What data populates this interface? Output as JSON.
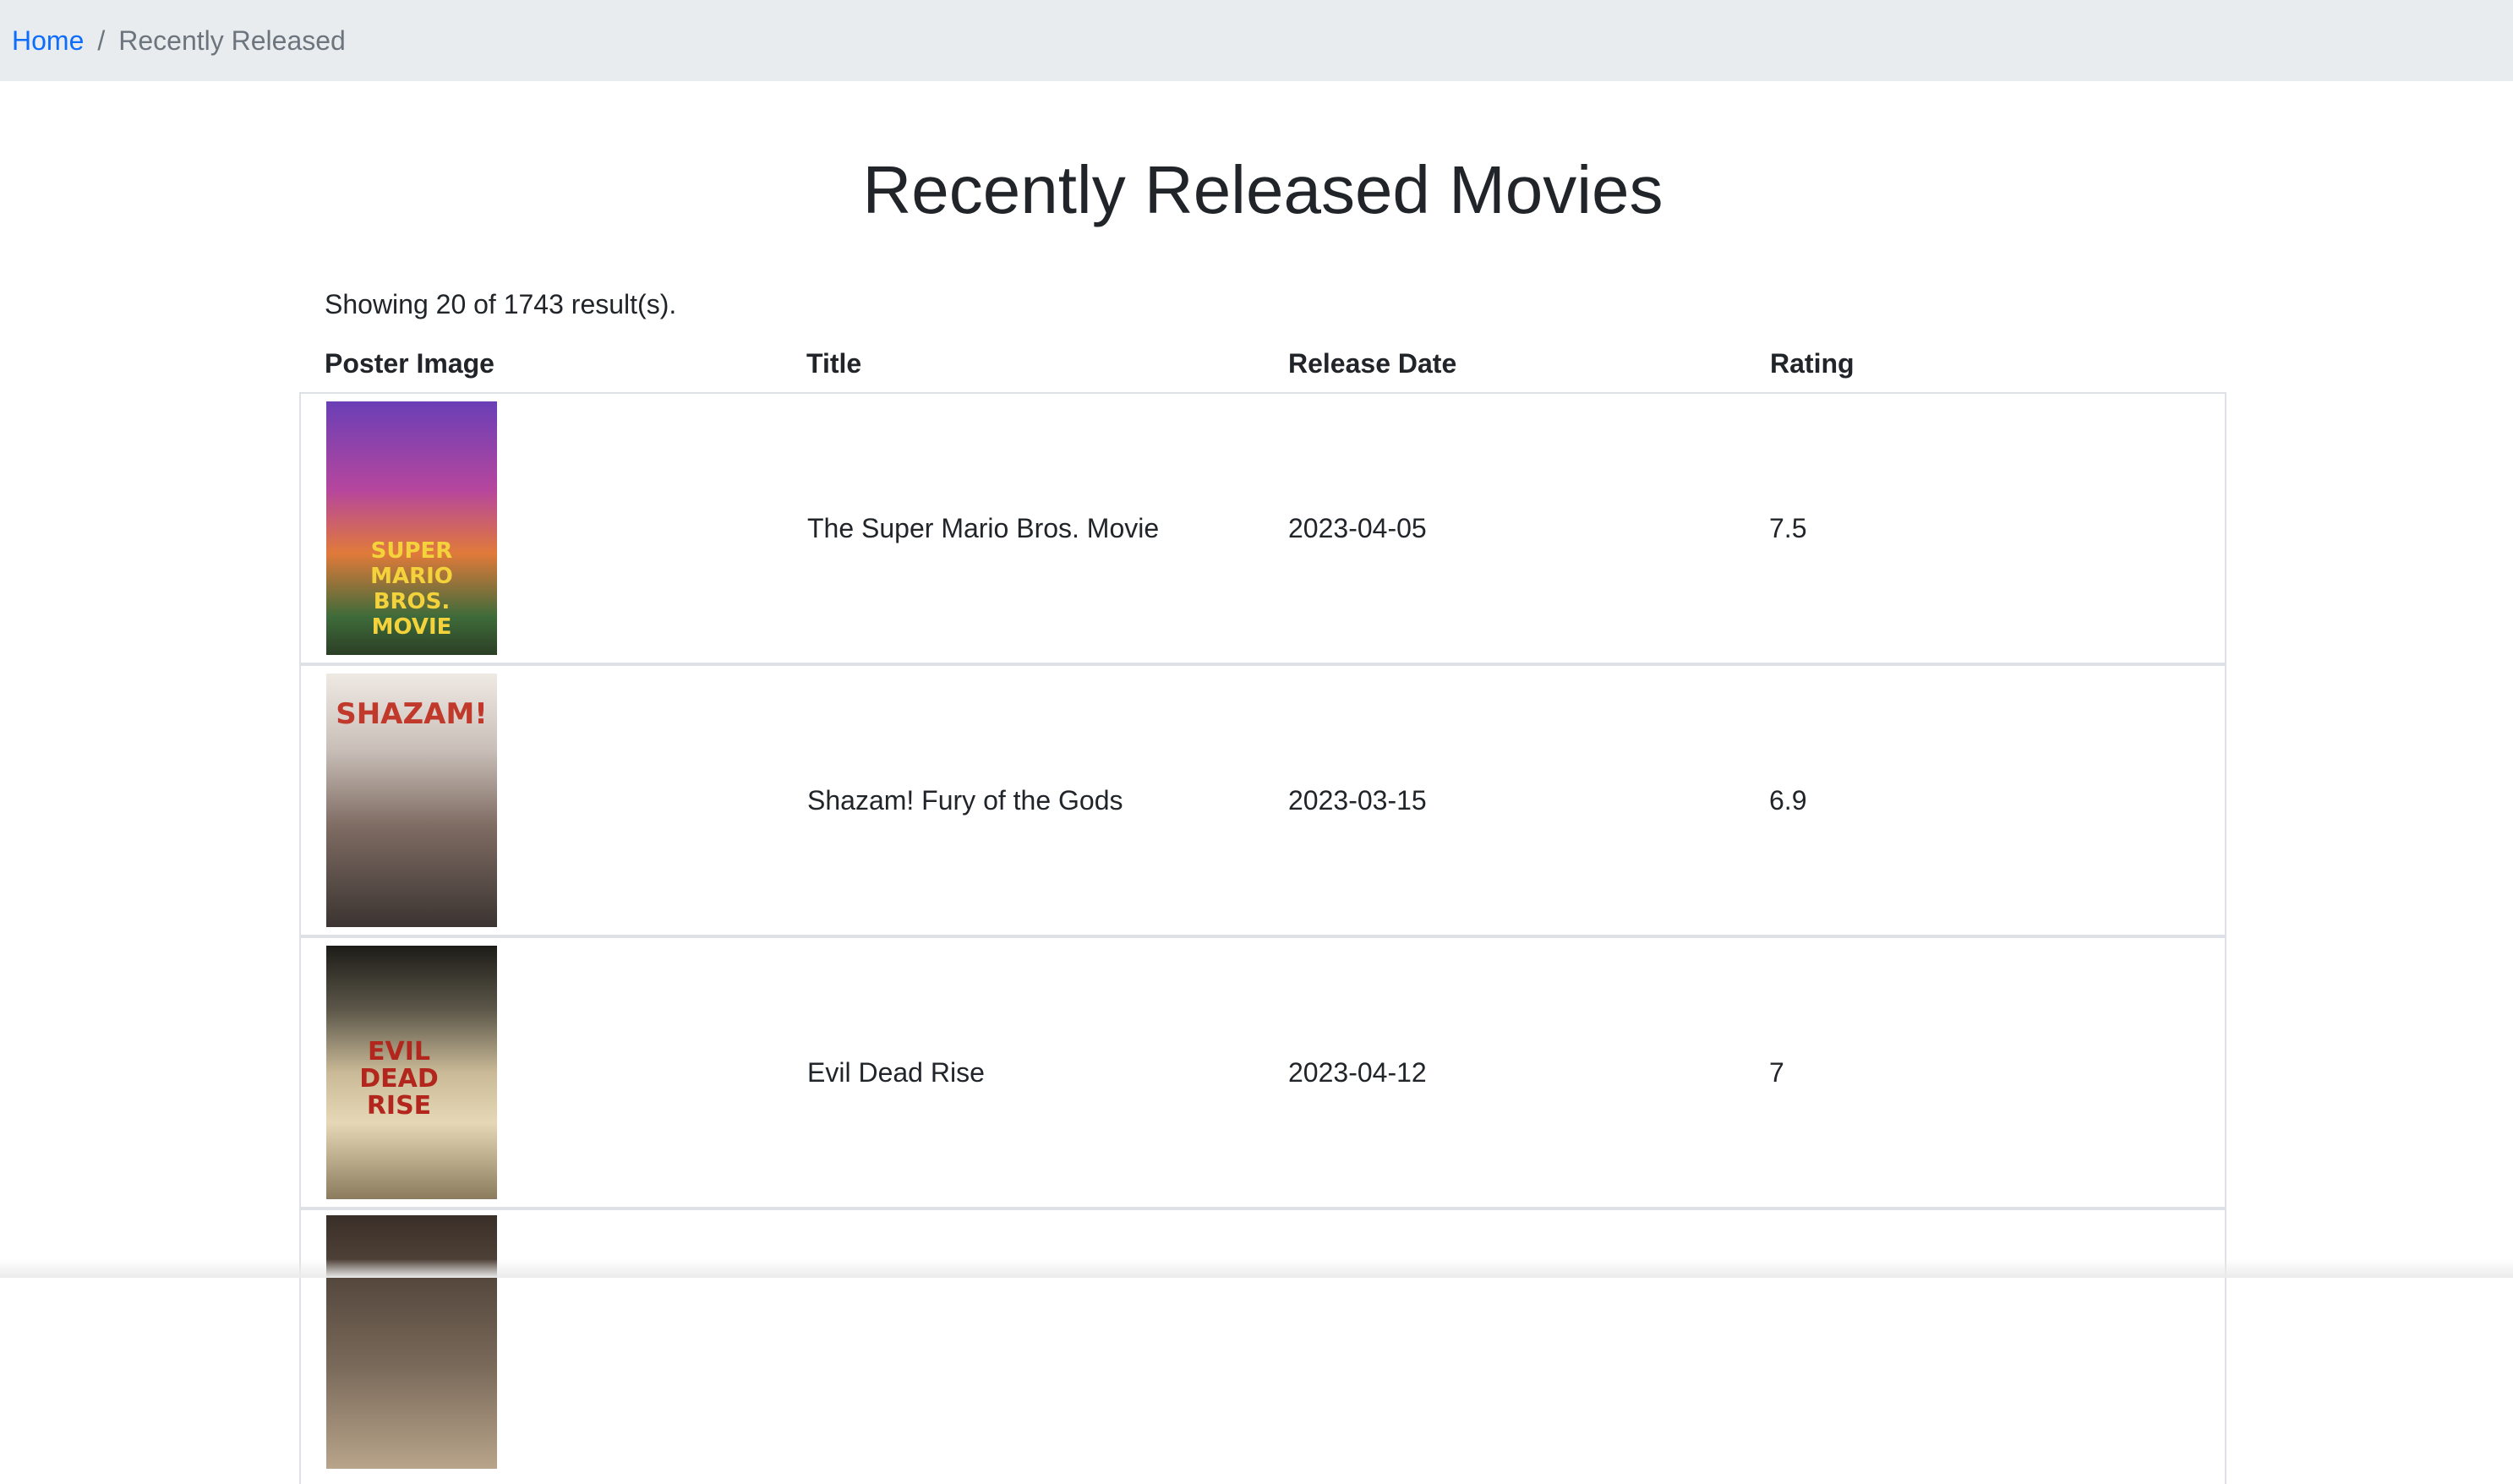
{
  "breadcrumb": {
    "home": "Home",
    "separator": "/",
    "current": "Recently Released"
  },
  "page": {
    "title": "Recently Released Movies",
    "results_text": "Showing 20 of 1743 result(s)."
  },
  "table": {
    "columns": [
      "Poster Image",
      "Title",
      "Release Date",
      "Rating"
    ],
    "rows": [
      {
        "poster_text": "SUPER MARIO BROS. MOVIE",
        "title": "The Super Mario Bros. Movie",
        "release_date": "2023-04-05",
        "rating": "7.5"
      },
      {
        "poster_text": "SHAZAM!",
        "title": "Shazam! Fury of the Gods",
        "release_date": "2023-03-15",
        "rating": "6.9"
      },
      {
        "poster_text": "EVIL DEAD RISE",
        "title": "Evil Dead Rise",
        "release_date": "2023-04-12",
        "rating": "7"
      }
    ]
  },
  "colors": {
    "link": "#0d6efd",
    "breadcrumb_bg": "#e9ecef",
    "muted": "#6c757d",
    "border": "#dee2e6"
  }
}
